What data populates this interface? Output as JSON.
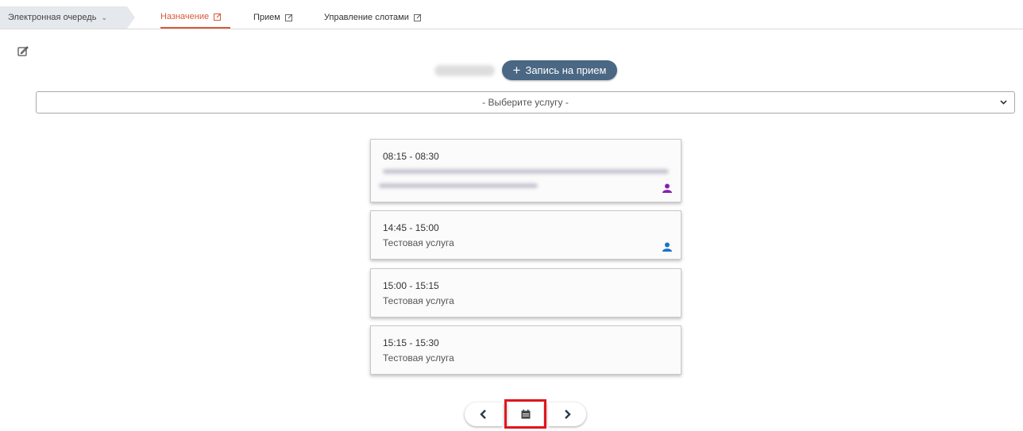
{
  "breadcrumb": {
    "label": "Электронная очередь",
    "chevron_icon": "chevron-down-icon"
  },
  "tabs": [
    {
      "label": "Назначение",
      "active": true,
      "icon": "edit-icon"
    },
    {
      "label": "Прием",
      "active": false,
      "icon": "edit-icon"
    },
    {
      "label": "Управление слотами",
      "active": false,
      "icon": "edit-icon"
    }
  ],
  "toolbar": {
    "add_label": "Запись на прием",
    "add_icon": "plus-icon"
  },
  "service_select": {
    "value": "- Выберите услугу -"
  },
  "slots": [
    {
      "time": "08:15 - 08:30",
      "service": "",
      "user_icon_color": "#8a1fb0"
    },
    {
      "time": "14:45 - 15:00",
      "service": "Тестовая услуга",
      "user_icon_color": "#1a73c9"
    },
    {
      "time": "15:00 - 15:15",
      "service": "Тестовая услуга"
    },
    {
      "time": "15:15 - 15:30",
      "service": "Тестовая услуга"
    }
  ],
  "pager": {
    "prev_icon": "chevron-left-icon",
    "calendar_icon": "calendar-icon",
    "next_icon": "chevron-right-icon"
  },
  "colors": {
    "accent": "#d9583b",
    "button": "#4a6784",
    "highlight": "#e0151b"
  }
}
